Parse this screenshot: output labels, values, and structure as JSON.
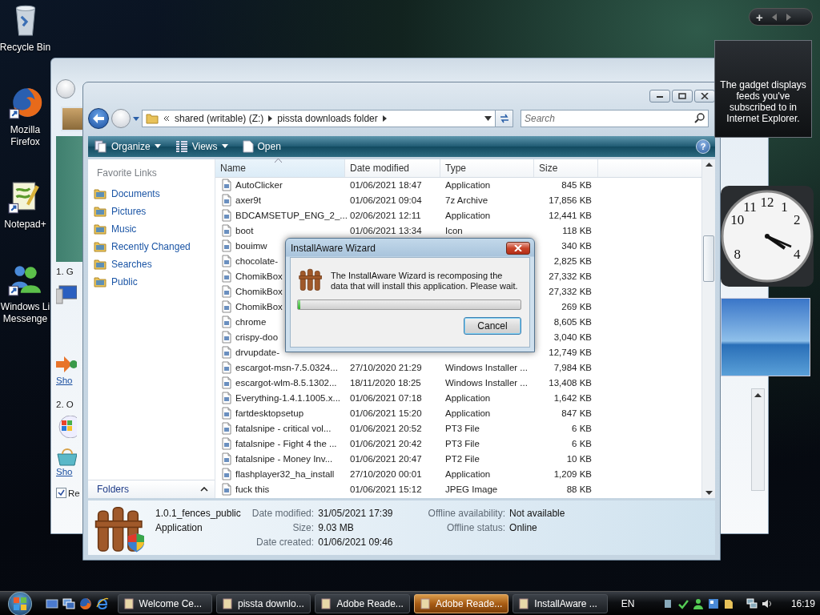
{
  "desktop_icons": [
    {
      "kind": "recycle-bin",
      "lines": [
        "Recycle Bin"
      ]
    },
    {
      "kind": "browser",
      "lines": [
        "Mozilla",
        "Firefox"
      ]
    },
    {
      "kind": "notepad",
      "lines": [
        "Notepad+"
      ]
    },
    {
      "kind": "messenger",
      "lines": [
        "Windows Li",
        "Messenge"
      ]
    }
  ],
  "background_window": {
    "steps": [
      "1. G",
      "2. O"
    ],
    "links": [
      "Sho",
      "Sho"
    ],
    "checkbox": {
      "label": "Re",
      "checked": true
    }
  },
  "explorer": {
    "address": {
      "crumbs": [
        "shared (writable) (Z:)",
        "pissta downloads folder"
      ]
    },
    "search": {
      "placeholder": "Search"
    },
    "toolbar": [
      {
        "kind": "menu",
        "label": "Organize"
      },
      {
        "kind": "menu",
        "label": "Views"
      },
      {
        "kind": "plain",
        "label": "Open"
      }
    ],
    "help": "?",
    "nav": {
      "heading": "Favorite Links",
      "items": [
        "Documents",
        "Pictures",
        "Music",
        "Recently Changed",
        "Searches",
        "Public"
      ],
      "folders": "Folders"
    },
    "columns": [
      "Name",
      "Date modified",
      "Type",
      "Size"
    ],
    "rows": [
      {
        "name": "AutoClicker",
        "date": "01/06/2021 18:47",
        "type": "Application",
        "size": "845 KB"
      },
      {
        "name": "axer9t",
        "date": "01/06/2021 09:04",
        "type": "7z Archive",
        "size": "17,856 KB"
      },
      {
        "name": "BDCAMSETUP_ENG_2_...",
        "date": "02/06/2021 12:11",
        "type": "Application",
        "size": "12,441 KB"
      },
      {
        "name": "boot",
        "date": "01/06/2021 13:34",
        "type": "Icon",
        "size": "118 KB"
      },
      {
        "name": "bouimw",
        "size": "340 KB"
      },
      {
        "name": "chocolate-",
        "size": "2,825 KB"
      },
      {
        "name": "ChomikBox",
        "size": "27,332 KB"
      },
      {
        "name": "ChomikBox",
        "size": "27,332 KB"
      },
      {
        "name": "ChomikBox",
        "size": "269 KB"
      },
      {
        "name": "chrome",
        "size": "8,605 KB"
      },
      {
        "name": "crispy-doo",
        "size": "3,040 KB"
      },
      {
        "name": "drvupdate-",
        "size": "12,749 KB"
      },
      {
        "name": "escargot-msn-7.5.0324...",
        "date": "27/10/2020 21:29",
        "type": "Windows Installer ...",
        "size": "7,984 KB"
      },
      {
        "name": "escargot-wlm-8.5.1302...",
        "date": "18/11/2020 18:25",
        "type": "Windows Installer ...",
        "size": "13,408 KB"
      },
      {
        "name": "Everything-1.4.1.1005.x...",
        "date": "01/06/2021 07:18",
        "type": "Application",
        "size": "1,642 KB"
      },
      {
        "name": "fartdesktopsetup",
        "date": "01/06/2021 15:20",
        "type": "Application",
        "size": "847 KB"
      },
      {
        "name": "fatalsnipe - critical vol...",
        "date": "01/06/2021 20:52",
        "type": "PT3 File",
        "size": "6 KB"
      },
      {
        "name": "fatalsnipe - Fight 4 the ...",
        "date": "01/06/2021 20:42",
        "type": "PT3 File",
        "size": "6 KB"
      },
      {
        "name": "fatalsnipe - Money Inv...",
        "date": "01/06/2021 20:47",
        "type": "PT2 File",
        "size": "10 KB"
      },
      {
        "name": "flashplayer32_ha_install",
        "date": "27/10/2020 00:01",
        "type": "Application",
        "size": "1,209 KB"
      },
      {
        "name": "fuck this",
        "date": "01/06/2021 15:12",
        "type": "JPEG Image",
        "size": "88 KB"
      }
    ],
    "details": {
      "name": "1.0.1_fences_public",
      "type": "Application",
      "fields": [
        {
          "label": "Date modified:",
          "value": "31/05/2021 17:39"
        },
        {
          "label": "Size:",
          "value": "9.03 MB"
        },
        {
          "label": "Date created:",
          "value": "01/06/2021 09:46"
        }
      ],
      "fields_2": [
        {
          "label": "Offline availability:",
          "value": "Not available"
        },
        {
          "label": "Offline status:",
          "value": "Online"
        }
      ]
    }
  },
  "dialog": {
    "title": "InstallAware Wizard",
    "message": "The InstallAware Wizard is recomposing the data that will install this application. Please wait.",
    "progress": {
      "level": 0.01
    },
    "button": "Cancel"
  },
  "gadgets": {
    "add": "+",
    "feed_text": "The gadget displays feeds you've subscribed to in Internet Explorer.",
    "clock_numerals": [
      "12",
      "1",
      "2",
      "4",
      "8",
      "10",
      "11"
    ]
  },
  "taskbar": {
    "tasks": [
      {
        "label": "Welcome Ce...",
        "selected": false
      },
      {
        "label": "pissta downlo...",
        "selected": false
      },
      {
        "label": "Adobe Reade...",
        "selected": false
      },
      {
        "label": "Adobe Reade...",
        "selected": true
      },
      {
        "label": "InstallAware ...",
        "selected": false
      }
    ],
    "language": "EN",
    "time": "16:19"
  }
}
